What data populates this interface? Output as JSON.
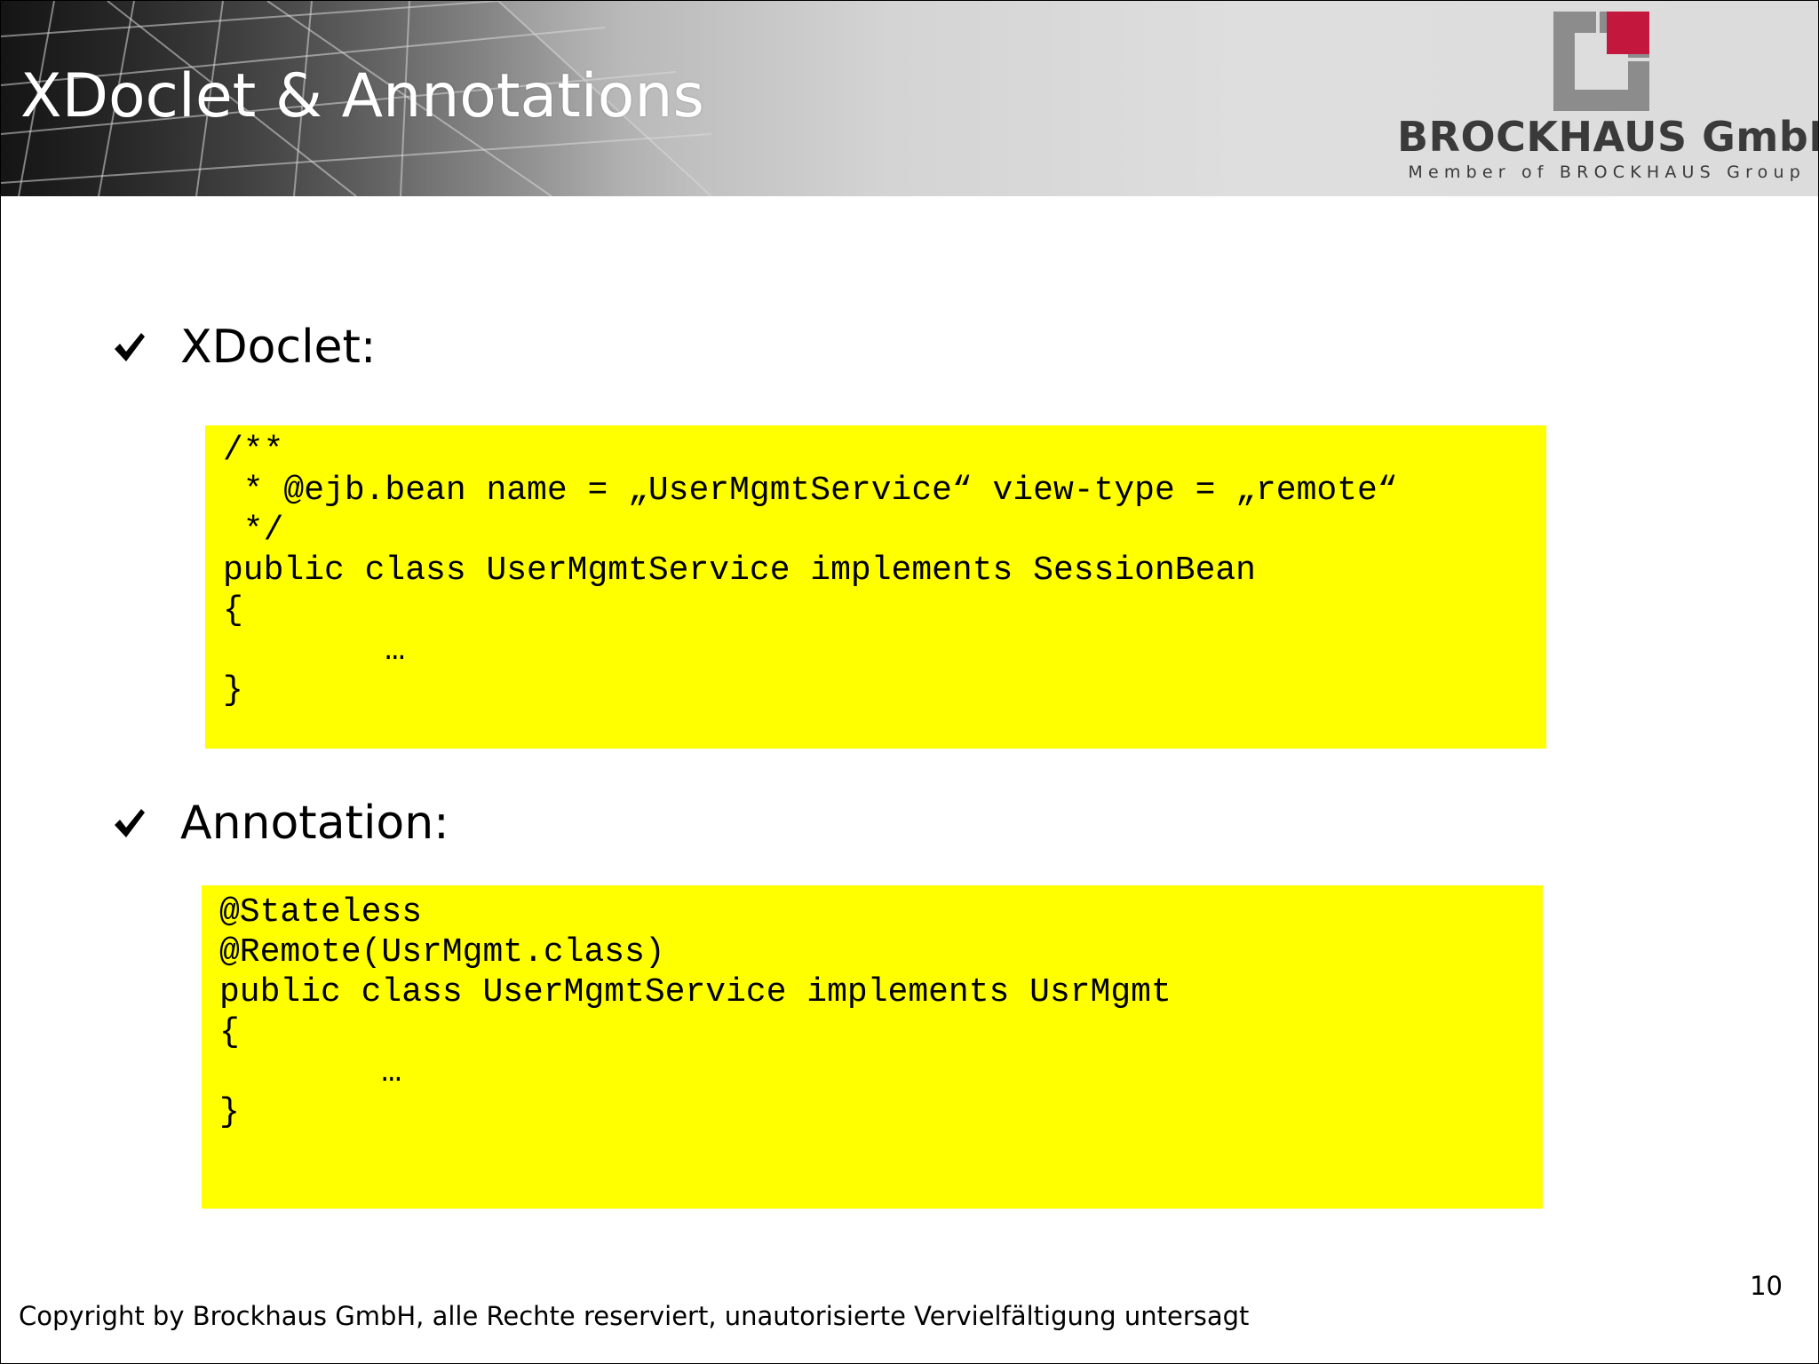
{
  "header": {
    "title": "XDoclet & Annotations"
  },
  "brand": {
    "name": "BROCKHAUS GmbH",
    "tagline": "Member of BROCKHAUS Group",
    "logo": {
      "icon": "brockhaus-logo-icon",
      "colors": {
        "frame": "#8c8c8c",
        "accent": "#c4173d"
      }
    }
  },
  "sections": [
    {
      "icon": "checkmark-icon",
      "label": "XDoclet:",
      "code": [
        "/**",
        " * @ejb.bean name = „UserMgmtService“ view-type = „remote“",
        " */",
        "public class UserMgmtService implements SessionBean",
        "{",
        "        …",
        "}"
      ]
    },
    {
      "icon": "checkmark-icon",
      "label": "Annotation:",
      "code": [
        "@Stateless",
        "@Remote(UsrMgmt.class)",
        "public class UserMgmtService implements UsrMgmt",
        "{",
        "        …",
        "}"
      ]
    }
  ],
  "colors": {
    "code_background": "#ffff00",
    "title_text": "#ffffff",
    "brand_text": "#3a3a3a"
  },
  "footer": {
    "page_number": "10",
    "copyright": "Copyright by Brockhaus GmbH, alle Rechte reserviert, unautorisierte Vervielfältigung untersagt"
  }
}
